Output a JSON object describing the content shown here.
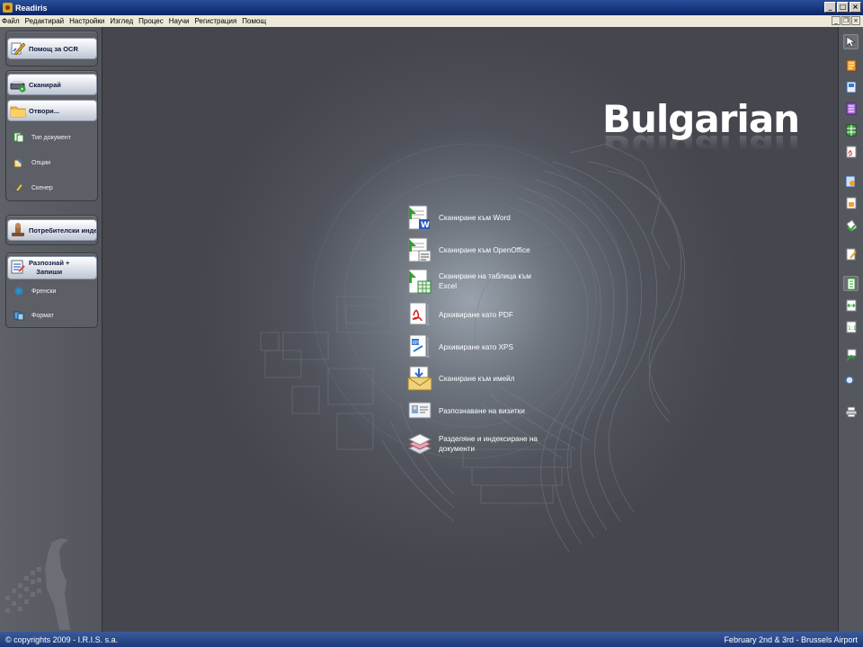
{
  "window": {
    "title": "Readiris"
  },
  "menu": [
    "Файл",
    "Редактирай",
    "Настройки",
    "Изглед",
    "Процес",
    "Научи",
    "Регистрация",
    "Помощ"
  ],
  "sidebar": {
    "help": "Помощ за OCR",
    "scan": "Сканирай",
    "open": "Отвори...",
    "doc_type": "Тип документ",
    "options": "Опции",
    "scanner": "Скенер",
    "user_dict": "Потребителски индекс",
    "recognize_line1": "Разпознай +",
    "recognize_line2": "Запиши",
    "language": "Френски",
    "format": "Формат"
  },
  "main": {
    "language_title": "Bulgarian",
    "actions": [
      {
        "label": "Сканиране към Word",
        "icon": "word-scan-icon"
      },
      {
        "label": "Сканиране към OpenOffice",
        "icon": "openoffice-scan-icon"
      },
      {
        "label": "Сканиране на таблица към Excel",
        "icon": "excel-scan-icon"
      },
      {
        "label": "Архивиране като PDF",
        "icon": "pdf-archive-icon"
      },
      {
        "label": "Архивиране като XPS",
        "icon": "xps-archive-icon"
      },
      {
        "label": "Сканиране към имейл",
        "icon": "email-scan-icon"
      },
      {
        "label": "Разпознаване на визитки",
        "icon": "business-card-icon"
      },
      {
        "label": "Разделяне и индексиране на документи",
        "icon": "split-index-icon"
      }
    ]
  },
  "footer": {
    "copyright": "© copyrights 2009 - I.R.I.S. s.a.",
    "event": "February 2nd & 3rd - Brussels Airport"
  }
}
